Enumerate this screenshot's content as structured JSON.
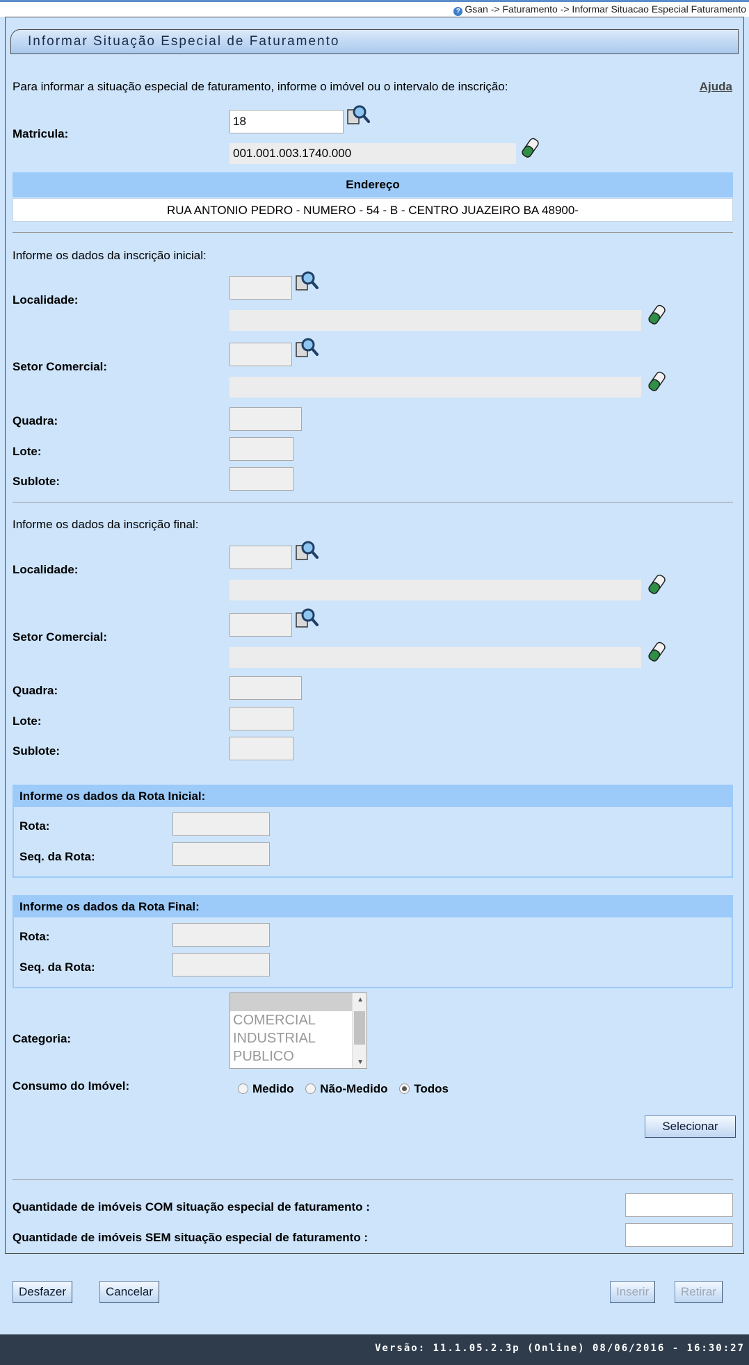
{
  "breadcrumb": "Gsan -> Faturamento -> Informar Situacao Especial Faturamento",
  "page_title": "Informar Situação Especial de Faturamento",
  "intro": "Para informar a situação especial de faturamento, informe o imóvel ou o intervalo de inscrição:",
  "help_link": "Ajuda",
  "matricula": {
    "label": "Matricula:",
    "value": "18",
    "inscricao": "001.001.003.1740.000"
  },
  "endereco": {
    "header": "Endereço",
    "value": "RUA ANTONIO PEDRO - NUMERO - 54   - B - CENTRO JUAZEIRO BA 48900-"
  },
  "inscricao_inicial": {
    "heading": "Informe os dados da inscrição inicial:",
    "localidade_label": "Localidade:",
    "setor_label": "Setor Comercial:",
    "quadra_label": "Quadra:",
    "lote_label": "Lote:",
    "sublote_label": "Sublote:"
  },
  "inscricao_final": {
    "heading": "Informe os dados da inscrição final:",
    "localidade_label": "Localidade:",
    "setor_label": "Setor Comercial:",
    "quadra_label": "Quadra:",
    "lote_label": "Lote:",
    "sublote_label": "Sublote:"
  },
  "rota_inicial": {
    "heading": "Informe os dados da Rota Inicial:",
    "rota_label": "Rota:",
    "seq_label": "Seq. da Rota:"
  },
  "rota_final": {
    "heading": "Informe os dados da Rota Final:",
    "rota_label": "Rota:",
    "seq_label": "Seq. da Rota:"
  },
  "categoria": {
    "label": "Categoria:",
    "options": [
      "COMERCIAL",
      "INDUSTRIAL",
      "PUBLICO"
    ]
  },
  "consumo": {
    "label": "Consumo do Imóvel:",
    "options": [
      "Medido",
      "Não-Medido",
      "Todos"
    ],
    "selected": "Todos"
  },
  "buttons": {
    "selecionar": "Selecionar",
    "desfazer": "Desfazer",
    "cancelar": "Cancelar",
    "inserir": "Inserir",
    "retirar": "Retirar"
  },
  "quantidades": {
    "com_label": "Quantidade de imóveis COM situação especial de faturamento :",
    "sem_label": "Quantidade de imóveis SEM situação especial de faturamento :"
  },
  "footer": "Versão: 11.1.05.2.3p (Online) 08/06/2016 - 16:30:27",
  "icons": {
    "search": "magnifier-search-icon",
    "clear": "eraser-icon"
  }
}
